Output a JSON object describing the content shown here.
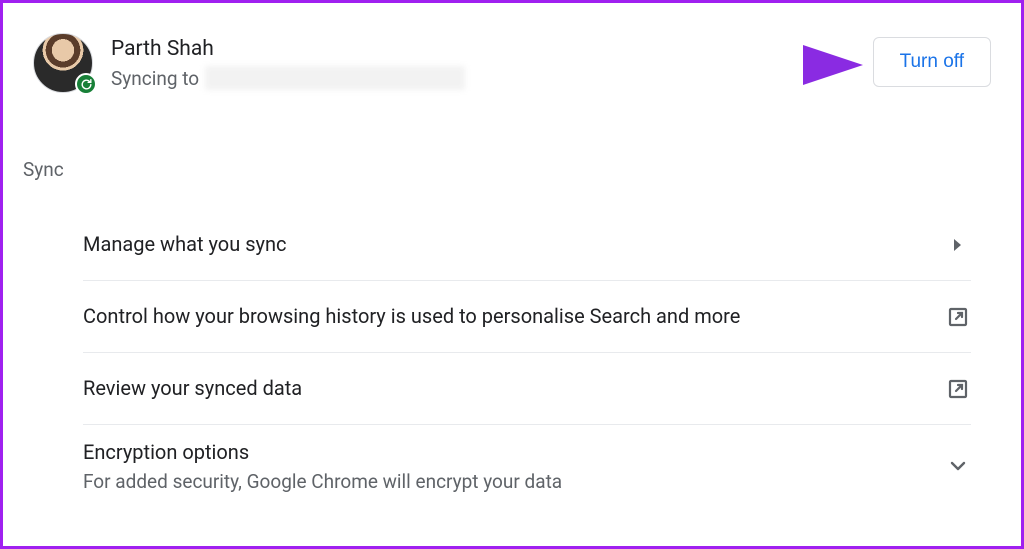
{
  "account": {
    "name": "Parth Shah",
    "syncing_label": "Syncing to",
    "turn_off_label": "Turn off"
  },
  "section": {
    "heading": "Sync",
    "items": [
      {
        "title": "Manage what you sync",
        "sub": "",
        "icon": "caret-right"
      },
      {
        "title": "Control how your browsing history is used to personalise Search and more",
        "sub": "",
        "icon": "external-link"
      },
      {
        "title": "Review your synced data",
        "sub": "",
        "icon": "external-link"
      },
      {
        "title": "Encryption options",
        "sub": "For added security, Google Chrome will encrypt your data",
        "icon": "chevron-down"
      }
    ]
  },
  "colors": {
    "accent": "#1a73e8",
    "border_highlight": "#a020f0",
    "sync_badge": "#188038"
  }
}
